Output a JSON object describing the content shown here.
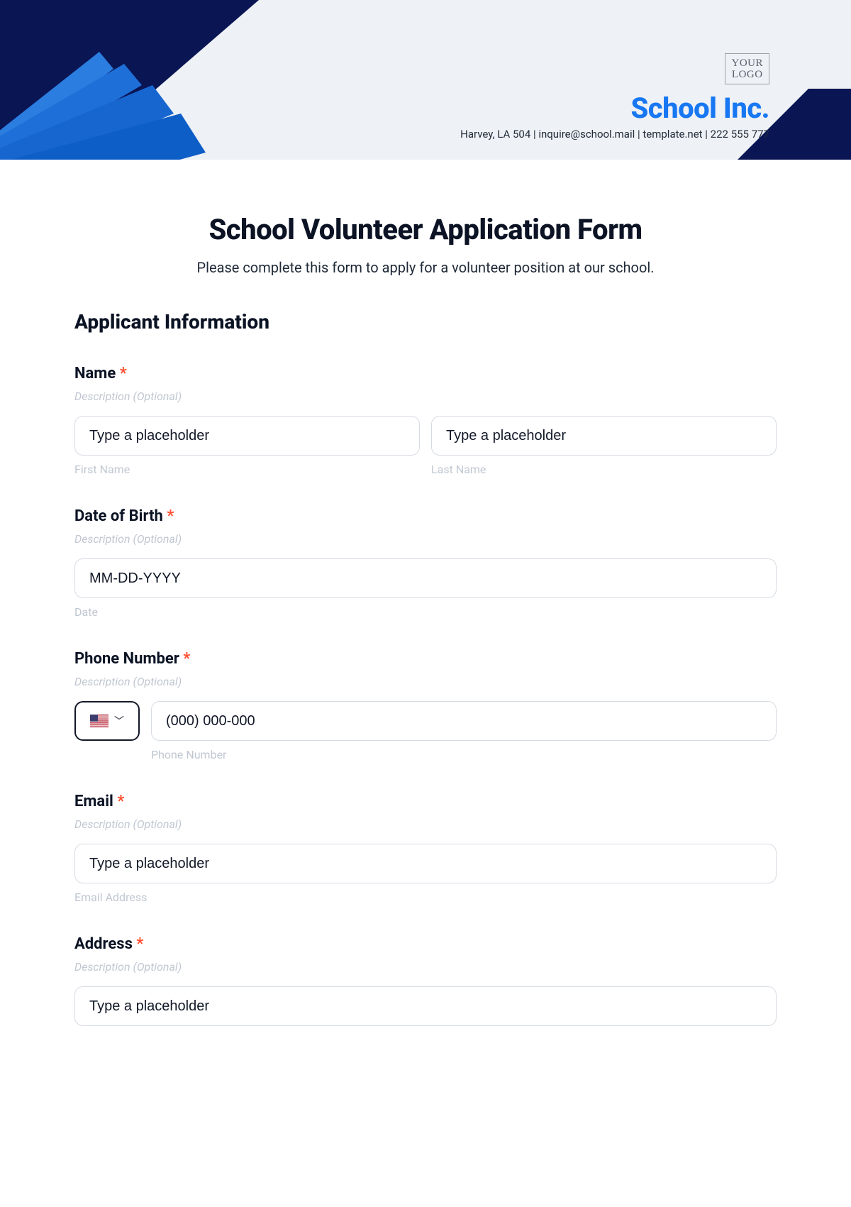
{
  "header": {
    "logo_l1": "YOUR",
    "logo_l2": "LOGO",
    "school_name": "School Inc.",
    "contact": "Harvey, LA 504 | inquire@school.mail | template.net | 222 555 777"
  },
  "form": {
    "title": "School Volunteer Application Form",
    "subtitle": "Please complete this form to apply for a volunteer position at our school.",
    "section": "Applicant Information",
    "desc_placeholder": "Description (Optional)",
    "common_placeholder": "Type a placeholder",
    "name": {
      "label": "Name",
      "first_sub": "First Name",
      "last_sub": "Last Name"
    },
    "dob": {
      "label": "Date of Birth",
      "placeholder": "MM-DD-YYYY",
      "sub": "Date"
    },
    "phone": {
      "label": "Phone Number",
      "placeholder": "(000) 000-000",
      "sub": "Phone Number"
    },
    "email": {
      "label": "Email",
      "sub": "Email Address"
    },
    "address": {
      "label": "Address"
    }
  }
}
